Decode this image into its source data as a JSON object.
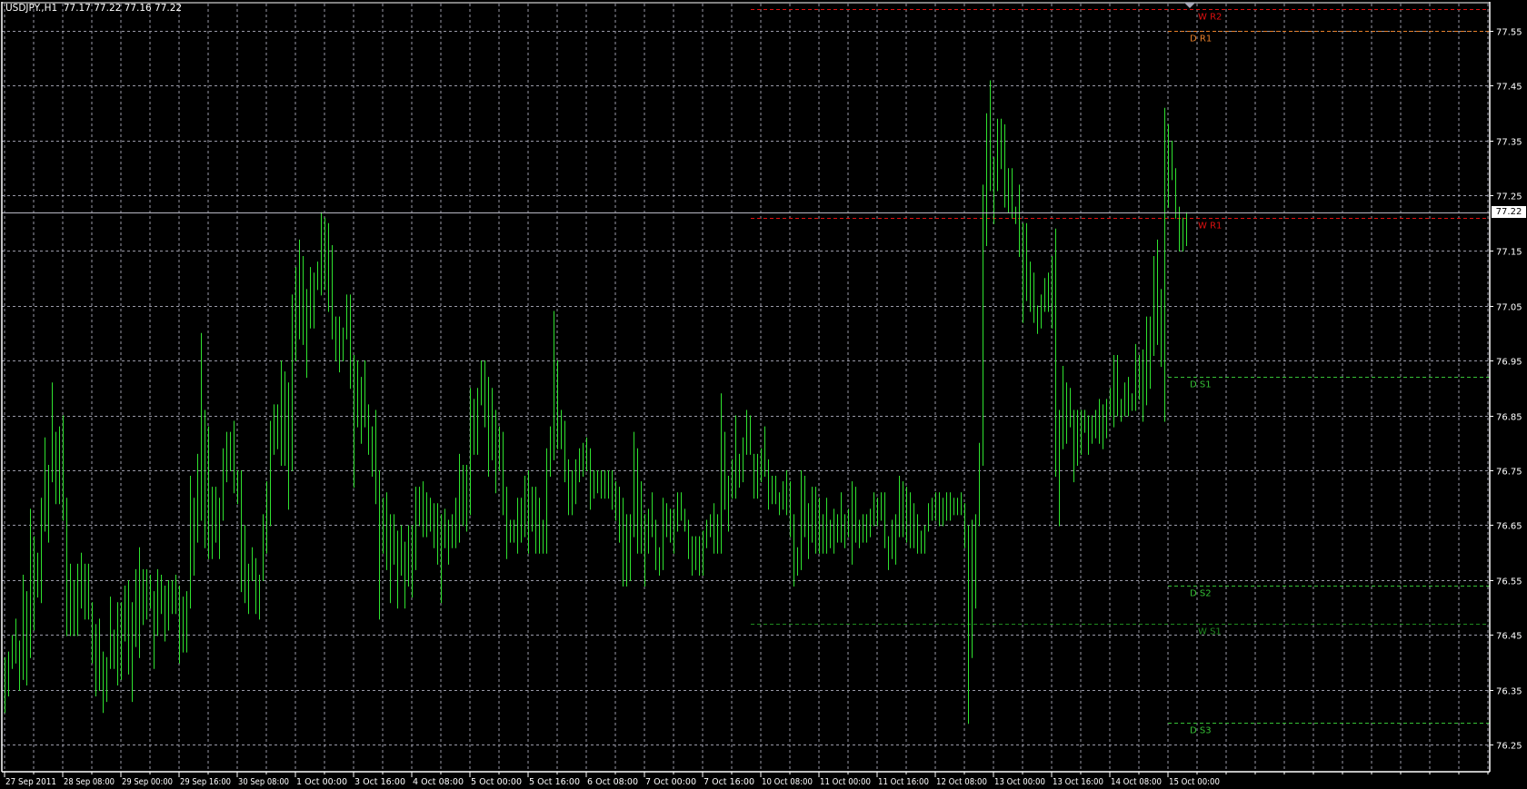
{
  "header": {
    "symbol_timeframe": "USDJPY.,H1",
    "ohlc": "77.17 77.22 77.16 77.22"
  },
  "colors": {
    "background": "#000000",
    "bars": "#2fe22f",
    "grid": "#9a9aa8",
    "axis": "#ffffff"
  },
  "chart_data": {
    "type": "ohlc-bar",
    "symbol": "USDJPY.",
    "timeframe": "H1",
    "ylim": [
      76.22,
      77.6
    ],
    "current_price": 77.22,
    "current_price_label": "77.22",
    "yticks": [
      "77.55",
      "77.45",
      "77.35",
      "77.25",
      "77.15",
      "77.05",
      "76.95",
      "76.85",
      "76.75",
      "76.65",
      "76.55",
      "76.45",
      "76.35",
      "76.25"
    ],
    "xticks": [
      "27 Sep 2011",
      "28 Sep 08:00",
      "29 Sep 00:00",
      "29 Sep 16:00",
      "30 Sep 08:00",
      "1 Oct 00:00",
      "3 Oct 16:00",
      "4 Oct 08:00",
      "5 Oct 00:00",
      "5 Oct 16:00",
      "6 Oct 08:00",
      "7 Oct 00:00",
      "7 Oct 16:00",
      "10 Oct 08:00",
      "11 Oct 00:00",
      "11 Oct 16:00",
      "12 Oct 08:00",
      "13 Oct 00:00",
      "13 Oct 16:00",
      "14 Oct 08:00",
      "15 Oct 00:00"
    ],
    "bars_per_xtick": 16,
    "levels": [
      {
        "label": "W R2",
        "price": 77.59,
        "color": "#e01010",
        "scope": "weekly"
      },
      {
        "label": "D R1",
        "price": 77.55,
        "color": "#e8802a",
        "scope": "daily"
      },
      {
        "label": "W R1",
        "price": 77.21,
        "color": "#e01010",
        "scope": "weekly"
      },
      {
        "label": "D S1",
        "price": 76.92,
        "color": "#35c035",
        "scope": "daily"
      },
      {
        "label": "D S2",
        "price": 76.54,
        "color": "#35c035",
        "scope": "daily"
      },
      {
        "label": "W S1",
        "price": 76.47,
        "color": "#1f8a1f",
        "scope": "weekly"
      },
      {
        "label": "D S3",
        "price": 76.29,
        "color": "#35c035",
        "scope": "daily"
      }
    ],
    "bars_high_low": [
      [
        76.41,
        76.31
      ],
      [
        76.42,
        76.34
      ],
      [
        76.45,
        76.39
      ],
      [
        76.48,
        76.4
      ],
      [
        76.44,
        76.35
      ],
      [
        76.56,
        76.37
      ],
      [
        76.53,
        76.36
      ],
      [
        76.68,
        76.41
      ],
      [
        76.63,
        76.46
      ],
      [
        76.6,
        76.52
      ],
      [
        76.7,
        76.51
      ],
      [
        76.81,
        76.64
      ],
      [
        76.76,
        76.62
      ],
      [
        76.91,
        76.73
      ],
      [
        76.82,
        76.69
      ],
      [
        76.83,
        76.69
      ],
      [
        76.85,
        76.66
      ],
      [
        76.7,
        76.45
      ],
      [
        76.58,
        76.45
      ],
      [
        76.55,
        76.45
      ],
      [
        76.58,
        76.45
      ],
      [
        76.6,
        76.5
      ],
      [
        76.58,
        76.48
      ],
      [
        76.58,
        76.48
      ],
      [
        76.51,
        76.4
      ],
      [
        76.47,
        76.34
      ],
      [
        76.48,
        76.35
      ],
      [
        76.42,
        76.31
      ],
      [
        76.41,
        76.33
      ],
      [
        76.52,
        76.39
      ],
      [
        76.46,
        76.39
      ],
      [
        76.51,
        76.36
      ],
      [
        76.51,
        76.37
      ],
      [
        76.54,
        76.44
      ],
      [
        76.55,
        76.38
      ],
      [
        76.51,
        76.33
      ],
      [
        76.57,
        76.43
      ],
      [
        76.61,
        76.41
      ],
      [
        76.57,
        76.47
      ],
      [
        76.57,
        76.48
      ],
      [
        76.56,
        76.5
      ],
      [
        76.53,
        76.39
      ],
      [
        76.57,
        76.45
      ],
      [
        76.56,
        76.49
      ],
      [
        76.54,
        76.44
      ],
      [
        76.55,
        76.46
      ],
      [
        76.55,
        76.49
      ],
      [
        76.56,
        76.49
      ],
      [
        76.54,
        76.4
      ],
      [
        76.52,
        76.42
      ],
      [
        76.53,
        76.42
      ],
      [
        76.74,
        76.5
      ],
      [
        76.7,
        76.56
      ],
      [
        76.78,
        76.62
      ],
      [
        77.0,
        76.66
      ],
      [
        76.86,
        76.61
      ],
      [
        76.83,
        76.59
      ],
      [
        76.72,
        76.59
      ],
      [
        76.72,
        76.62
      ],
      [
        76.7,
        76.59
      ],
      [
        76.79,
        76.66
      ],
      [
        76.82,
        76.73
      ],
      [
        76.82,
        76.75
      ],
      [
        76.84,
        76.71
      ],
      [
        76.75,
        76.69
      ],
      [
        76.75,
        76.53
      ],
      [
        76.65,
        76.51
      ],
      [
        76.58,
        76.49
      ],
      [
        76.61,
        76.55
      ],
      [
        76.59,
        76.49
      ],
      [
        76.56,
        76.48
      ],
      [
        76.67,
        76.55
      ],
      [
        76.73,
        76.6
      ],
      [
        76.84,
        76.65
      ],
      [
        76.87,
        76.78
      ],
      [
        76.87,
        76.79
      ],
      [
        76.95,
        76.76
      ],
      [
        76.93,
        76.76
      ],
      [
        76.91,
        76.68
      ],
      [
        77.07,
        76.75
      ],
      [
        77.12,
        76.95
      ],
      [
        77.17,
        76.99
      ],
      [
        77.14,
        76.98
      ],
      [
        77.08,
        76.92
      ],
      [
        77.12,
        77.01
      ],
      [
        77.11,
        77.01
      ],
      [
        77.13,
        77.08
      ],
      [
        77.22,
        77.07
      ],
      [
        77.21,
        77.08
      ],
      [
        77.2,
        77.04
      ],
      [
        77.16,
        76.99
      ],
      [
        77.03,
        76.95
      ],
      [
        77.03,
        76.93
      ],
      [
        77.01,
        76.95
      ],
      [
        77.07,
        76.99
      ],
      [
        77.07,
        76.9
      ],
      [
        76.96,
        76.72
      ],
      [
        76.95,
        76.83
      ],
      [
        76.92,
        76.8
      ],
      [
        76.95,
        76.83
      ],
      [
        76.87,
        76.78
      ],
      [
        76.83,
        76.74
      ],
      [
        76.86,
        76.69
      ],
      [
        76.75,
        76.48
      ],
      [
        76.7,
        76.6
      ],
      [
        76.71,
        76.57
      ],
      [
        76.67,
        76.51
      ],
      [
        76.67,
        76.58
      ],
      [
        76.64,
        76.5
      ],
      [
        76.65,
        76.56
      ],
      [
        76.62,
        76.5
      ],
      [
        76.65,
        76.54
      ],
      [
        76.65,
        76.52
      ],
      [
        76.72,
        76.57
      ],
      [
        76.72,
        76.65
      ],
      [
        76.73,
        76.63
      ],
      [
        76.71,
        76.63
      ],
      [
        76.7,
        76.64
      ],
      [
        76.69,
        76.61
      ],
      [
        76.69,
        76.58
      ],
      [
        76.67,
        76.51
      ],
      [
        76.68,
        76.61
      ],
      [
        76.66,
        76.58
      ],
      [
        76.67,
        76.61
      ],
      [
        76.7,
        76.61
      ],
      [
        76.78,
        76.62
      ],
      [
        76.76,
        76.65
      ],
      [
        76.76,
        76.64
      ],
      [
        76.9,
        76.67
      ],
      [
        76.88,
        76.78
      ],
      [
        76.9,
        76.78
      ],
      [
        76.95,
        76.87
      ],
      [
        76.95,
        76.83
      ],
      [
        76.92,
        76.74
      ],
      [
        76.9,
        76.77
      ],
      [
        76.86,
        76.71
      ],
      [
        76.83,
        76.75
      ],
      [
        76.82,
        76.67
      ],
      [
        76.72,
        76.59
      ],
      [
        76.66,
        76.62
      ],
      [
        76.66,
        76.62
      ],
      [
        76.7,
        76.6
      ],
      [
        76.7,
        76.62
      ],
      [
        76.74,
        76.63
      ],
      [
        76.75,
        76.6
      ],
      [
        76.72,
        76.64
      ],
      [
        76.72,
        76.6
      ],
      [
        76.7,
        76.6
      ],
      [
        76.66,
        76.6
      ],
      [
        76.79,
        76.6
      ],
      [
        76.83,
        76.74
      ],
      [
        77.04,
        76.77
      ],
      [
        76.95,
        76.79
      ],
      [
        76.86,
        76.79
      ],
      [
        76.84,
        76.73
      ],
      [
        76.77,
        76.67
      ],
      [
        76.75,
        76.67
      ],
      [
        76.77,
        76.69
      ],
      [
        76.79,
        76.73
      ],
      [
        76.8,
        76.74
      ],
      [
        76.81,
        76.75
      ],
      [
        76.79,
        76.68
      ],
      [
        76.75,
        76.7
      ],
      [
        76.75,
        76.71
      ],
      [
        76.75,
        76.7
      ],
      [
        76.75,
        76.7
      ],
      [
        76.75,
        76.7
      ],
      [
        76.75,
        76.68
      ],
      [
        76.73,
        76.66
      ],
      [
        76.72,
        76.62
      ],
      [
        76.7,
        76.54
      ],
      [
        76.67,
        76.54
      ],
      [
        76.67,
        76.55
      ],
      [
        76.82,
        76.63
      ],
      [
        76.79,
        76.6
      ],
      [
        76.73,
        76.6
      ],
      [
        76.67,
        76.54
      ],
      [
        76.68,
        76.6
      ],
      [
        76.71,
        76.63
      ],
      [
        76.66,
        76.57
      ],
      [
        76.61,
        76.56
      ],
      [
        76.7,
        76.57
      ],
      [
        76.69,
        76.63
      ],
      [
        76.68,
        76.62
      ],
      [
        76.68,
        76.6
      ],
      [
        76.71,
        76.64
      ],
      [
        76.71,
        76.66
      ],
      [
        76.68,
        76.64
      ],
      [
        76.66,
        76.59
      ],
      [
        76.63,
        76.56
      ],
      [
        76.63,
        76.57
      ],
      [
        76.63,
        76.56
      ],
      [
        76.64,
        76.56
      ],
      [
        76.66,
        76.61
      ],
      [
        76.67,
        76.63
      ],
      [
        76.69,
        76.6
      ],
      [
        76.67,
        76.6
      ],
      [
        76.89,
        76.6
      ],
      [
        76.82,
        76.68
      ],
      [
        76.74,
        76.64
      ],
      [
        76.77,
        76.7
      ],
      [
        76.85,
        76.7
      ],
      [
        76.78,
        76.72
      ],
      [
        76.81,
        76.73
      ],
      [
        76.86,
        76.78
      ],
      [
        76.85,
        76.78
      ],
      [
        76.78,
        76.7
      ],
      [
        76.78,
        76.7
      ],
      [
        76.79,
        76.73
      ],
      [
        76.83,
        76.74
      ],
      [
        76.77,
        76.68
      ],
      [
        76.74,
        76.69
      ],
      [
        76.74,
        76.69
      ],
      [
        76.71,
        76.67
      ],
      [
        76.73,
        76.68
      ],
      [
        76.75,
        76.67
      ],
      [
        76.73,
        76.63
      ],
      [
        76.67,
        76.54
      ],
      [
        76.61,
        76.56
      ],
      [
        76.75,
        76.57
      ],
      [
        76.74,
        76.63
      ],
      [
        76.69,
        76.59
      ],
      [
        76.72,
        76.62
      ],
      [
        76.72,
        76.6
      ],
      [
        76.7,
        76.6
      ],
      [
        76.67,
        76.6
      ],
      [
        76.7,
        76.6
      ],
      [
        76.66,
        76.61
      ],
      [
        76.68,
        76.6
      ],
      [
        76.67,
        76.62
      ],
      [
        76.71,
        76.62
      ],
      [
        76.67,
        76.61
      ],
      [
        76.68,
        76.63
      ],
      [
        76.73,
        76.58
      ],
      [
        76.72,
        76.62
      ],
      [
        76.66,
        76.61
      ],
      [
        76.67,
        76.62
      ],
      [
        76.67,
        76.62
      ],
      [
        76.68,
        76.63
      ],
      [
        76.71,
        76.65
      ],
      [
        76.7,
        76.65
      ],
      [
        76.71,
        76.66
      ],
      [
        76.71,
        76.61
      ],
      [
        76.63,
        76.57
      ],
      [
        76.66,
        76.59
      ],
      [
        76.67,
        76.58
      ],
      [
        76.74,
        76.63
      ],
      [
        76.73,
        76.63
      ],
      [
        76.72,
        76.62
      ],
      [
        76.71,
        76.61
      ],
      [
        76.69,
        76.61
      ],
      [
        76.67,
        76.6
      ],
      [
        76.64,
        76.6
      ],
      [
        76.65,
        76.6
      ],
      [
        76.69,
        76.64
      ],
      [
        76.7,
        76.66
      ],
      [
        76.71,
        76.66
      ],
      [
        76.71,
        76.65
      ],
      [
        76.7,
        76.65
      ],
      [
        76.71,
        76.66
      ],
      [
        76.71,
        76.66
      ],
      [
        76.7,
        76.67
      ],
      [
        76.7,
        76.67
      ],
      [
        76.71,
        76.67
      ],
      [
        76.69,
        76.61
      ],
      [
        76.65,
        76.29
      ],
      [
        76.66,
        76.41
      ],
      [
        76.67,
        76.5
      ],
      [
        76.8,
        76.65
      ],
      [
        77.27,
        76.76
      ],
      [
        77.4,
        77.16
      ],
      [
        77.46,
        77.26
      ],
      [
        77.32,
        77.2
      ],
      [
        77.39,
        77.26
      ],
      [
        77.39,
        77.3
      ],
      [
        77.38,
        77.23
      ],
      [
        77.3,
        77.22
      ],
      [
        77.3,
        77.21
      ],
      [
        77.23,
        77.2
      ],
      [
        77.27,
        77.14
      ],
      [
        77.2,
        77.02
      ],
      [
        77.2,
        77.06
      ],
      [
        77.13,
        77.04
      ],
      [
        77.11,
        77.02
      ],
      [
        77.05,
        77.0
      ],
      [
        77.07,
        77.01
      ],
      [
        77.1,
        77.04
      ],
      [
        77.11,
        77.04
      ],
      [
        77.14,
        77.01
      ],
      [
        77.19,
        76.74
      ],
      [
        76.86,
        76.65
      ],
      [
        76.94,
        76.79
      ],
      [
        76.91,
        76.8
      ],
      [
        76.9,
        76.83
      ],
      [
        76.86,
        76.73
      ],
      [
        76.86,
        76.76
      ],
      [
        76.86,
        76.78
      ],
      [
        76.86,
        76.82
      ],
      [
        76.85,
        76.78
      ],
      [
        76.85,
        76.8
      ],
      [
        76.86,
        76.81
      ],
      [
        76.88,
        76.8
      ],
      [
        76.87,
        76.79
      ],
      [
        76.88,
        76.81
      ],
      [
        76.9,
        76.85
      ],
      [
        76.96,
        76.83
      ],
      [
        76.96,
        76.85
      ],
      [
        76.88,
        76.84
      ],
      [
        76.91,
        76.85
      ],
      [
        76.92,
        76.85
      ],
      [
        76.89,
        76.86
      ],
      [
        76.98,
        76.86
      ],
      [
        76.96,
        76.88
      ],
      [
        76.97,
        76.84
      ],
      [
        77.03,
        76.87
      ],
      [
        77.03,
        76.9
      ],
      [
        77.14,
        76.96
      ],
      [
        77.17,
        76.98
      ],
      [
        77.08,
        76.94
      ],
      [
        77.41,
        76.84
      ],
      [
        77.38,
        77.23
      ],
      [
        77.35,
        77.28
      ],
      [
        77.3,
        77.21
      ],
      [
        77.23,
        77.15
      ],
      [
        77.21,
        77.15
      ],
      [
        77.22,
        77.16
      ]
    ]
  }
}
